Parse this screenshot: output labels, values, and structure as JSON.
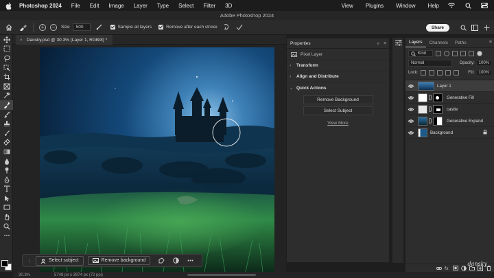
{
  "menubar": {
    "app_name": "Photoshop 2024",
    "items": [
      "File",
      "Edit",
      "Image",
      "Layer",
      "Type",
      "Select",
      "Filter",
      "3D"
    ],
    "right_items": [
      "View",
      "Plugins",
      "Window",
      "Help"
    ]
  },
  "window": {
    "title": "Adobe Photoshop 2024"
  },
  "options": {
    "size_label": "Size",
    "size_value": "500",
    "sample_all_layers": "Sample all layers",
    "remove_after_stroke": "Remove after each stroke",
    "share_label": "Share"
  },
  "document": {
    "tab_title": "Dansky.psd @ 30.3% (Layer 1, RGB/8) *"
  },
  "context_bar": {
    "select_subject": "Select subject",
    "remove_background": "Remove background"
  },
  "status": {
    "zoom": "30.3%",
    "info": "5748 px x 3974 px (72 ppi)"
  },
  "properties": {
    "title": "Properties",
    "layer_type": "Pixel Layer",
    "sections": [
      "Transform",
      "Align and Distribute",
      "Quick Actions"
    ],
    "buttons": [
      "Remove Background",
      "Select Subject"
    ],
    "view_more": "View More"
  },
  "layers_panel": {
    "tabs": [
      "Layers",
      "Channels",
      "Paths"
    ],
    "filter_kind": "Kind",
    "blend_mode": "Normal",
    "opacity_label": "Opacity:",
    "opacity_value": "100%",
    "lock_label": "Lock:",
    "fill_label": "Fill:",
    "fill_value": "100%",
    "layers": [
      {
        "name": "Layer 1"
      },
      {
        "name": "Generative Fill"
      },
      {
        "name": "castle"
      },
      {
        "name": "Generative Expand"
      },
      {
        "name": "Background"
      }
    ]
  },
  "watermark": "dansky",
  "colors": {
    "canvas_sky": "#0e3a5e",
    "grass": "#2f7a3a",
    "panel_bg": "#2d2d2d",
    "toolbar_bg": "#2b2b2b"
  },
  "icons": [
    "apple-icon",
    "home-icon",
    "brush-icon",
    "search-icon",
    "wifi-icon",
    "control-center-icon"
  ]
}
